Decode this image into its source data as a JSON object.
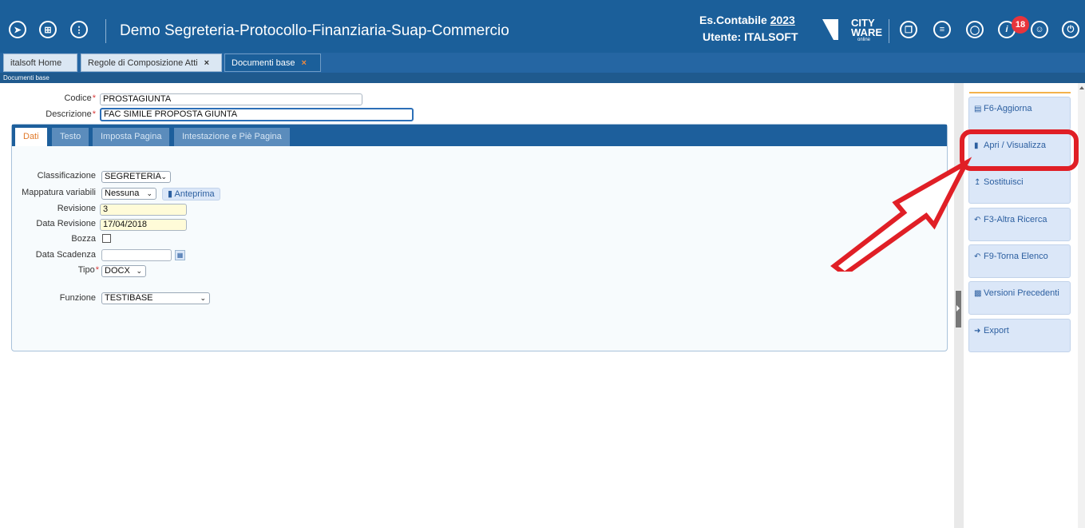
{
  "header": {
    "title": "Demo Segreteria-Protocollo-Finanziaria-Suap-Commercio",
    "es_label": "Es.Contabile",
    "es_year": "2023",
    "user_label": "Utente: ITALSOFT",
    "logo_line1": "CITY",
    "logo_line2": "WARE",
    "logo_line3": "online",
    "notification_count": "18",
    "left_icons": [
      "rocket-icon",
      "apps-icon",
      "more-icon"
    ],
    "right_icons": [
      "windows-icon",
      "stack-icon",
      "headset-icon",
      "info-icon",
      "user-icon",
      "power-icon"
    ]
  },
  "tabs": [
    {
      "label": "italsoft Home"
    },
    {
      "label": "Regole di Composizione Atti",
      "close": "×"
    },
    {
      "label": "Documenti base",
      "close": "×"
    }
  ],
  "breadcrumb": "Documenti base",
  "form": {
    "codice_label": "Codice",
    "codice_value": "PROSTAGIUNTA",
    "descrizione_label": "Descrizione",
    "descrizione_value": "FAC SIMILE PROPOSTA GIUNTA",
    "required_mark": "*"
  },
  "form_tabs": [
    "Dati",
    "Testo",
    "Imposta Pagina",
    "Intestazione e Piè Pagina"
  ],
  "dati": {
    "classificazione_label": "Classificazione",
    "classificazione_value": "SEGRETERIA",
    "mappatura_label": "Mappatura variabili",
    "mappatura_value": "Nessuna",
    "anteprima_label": "Anteprima",
    "revisione_label": "Revisione",
    "revisione_value": "3",
    "data_revisione_label": "Data Revisione",
    "data_revisione_value": "17/04/2018",
    "bozza_label": "Bozza",
    "data_scadenza_label": "Data Scadenza",
    "data_scadenza_value": "",
    "tipo_label": "Tipo",
    "tipo_value": "DOCX",
    "funzione_label": "Funzione",
    "funzione_value": "TESTIBASE"
  },
  "actions": [
    {
      "label": "F6-Aggiorna",
      "icon": "save-icon"
    },
    {
      "label": "Apri / Visualizza",
      "icon": "document-icon"
    },
    {
      "label": "Sostituisci",
      "icon": "upload-icon"
    },
    {
      "label": "F3-Altra Ricerca",
      "icon": "back-icon"
    },
    {
      "label": "F9-Torna Elenco",
      "icon": "back-icon"
    },
    {
      "label": "Versioni Precedenti",
      "icon": "versions-icon"
    },
    {
      "label": "Export",
      "icon": "arrow-right-icon"
    }
  ],
  "colors": {
    "header_bg": "#1b5f9a",
    "highlight_red": "#e01f26",
    "active_tab_text": "#e17a2b"
  }
}
